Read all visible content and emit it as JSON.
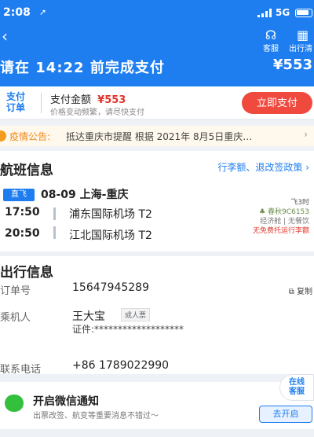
{
  "status_bar": {
    "time": "2:08",
    "location_arrow": "➚",
    "network": "5G"
  },
  "header": {
    "back_glyph": "‹",
    "service_label": "客服",
    "guide_label": "出行清",
    "pay_prompt": "请在 14:22 前完成支付",
    "amount": "¥553"
  },
  "payment": {
    "badge": "支付\n订单",
    "label": "支付金额",
    "price": "¥553",
    "subtext": "价格变动频繁，请尽快支付",
    "button": "立即支付"
  },
  "notice": {
    "label": "疫情公告:",
    "text": "抵达重庆市提醒 根据 2021年 8月5日重庆…",
    "arrow": "›"
  },
  "flight": {
    "title": "航班信息",
    "policy_link": "行李额、退改签政策 ›",
    "direct_badge": "直飞",
    "route": "08-09 上海-重庆",
    "depart_time": "17:50",
    "arrive_time": "20:50",
    "depart_airport": "浦东国际机场 T2",
    "arrive_airport": "江北国际机场 T2",
    "duration": "飞3时",
    "airline": "春秋9C6153",
    "cabin": "经济舱 | 无餐饮",
    "baggage": "无免费托运行李额"
  },
  "travel": {
    "title": "出行信息",
    "order_label": "订单号",
    "order_no": "15647945289",
    "copy_label": "复制",
    "passenger_label": "乘机人",
    "passenger_name": "王大宝",
    "passenger_type": "成人票",
    "id_line": "证件:*******************",
    "phone_label": "联系电话",
    "phone": "+86 1789022990"
  },
  "wechat": {
    "title": "开启微信通知",
    "subtitle": "出票改签、航变等重要消息不错过～",
    "button": "去开启"
  },
  "float_service": {
    "label": "在线\n客服"
  },
  "colors": {
    "brand": "#1e7ef0",
    "price": "#e0352b",
    "pay_button": "#f04a3f",
    "notice": "#f08a1c"
  },
  "icons": [
    "location-arrow-icon",
    "signal-icon",
    "battery-icon",
    "back-icon",
    "headset-icon",
    "guide-icon",
    "notice-icon",
    "copy-icon",
    "airline-icon",
    "wechat-icon"
  ]
}
